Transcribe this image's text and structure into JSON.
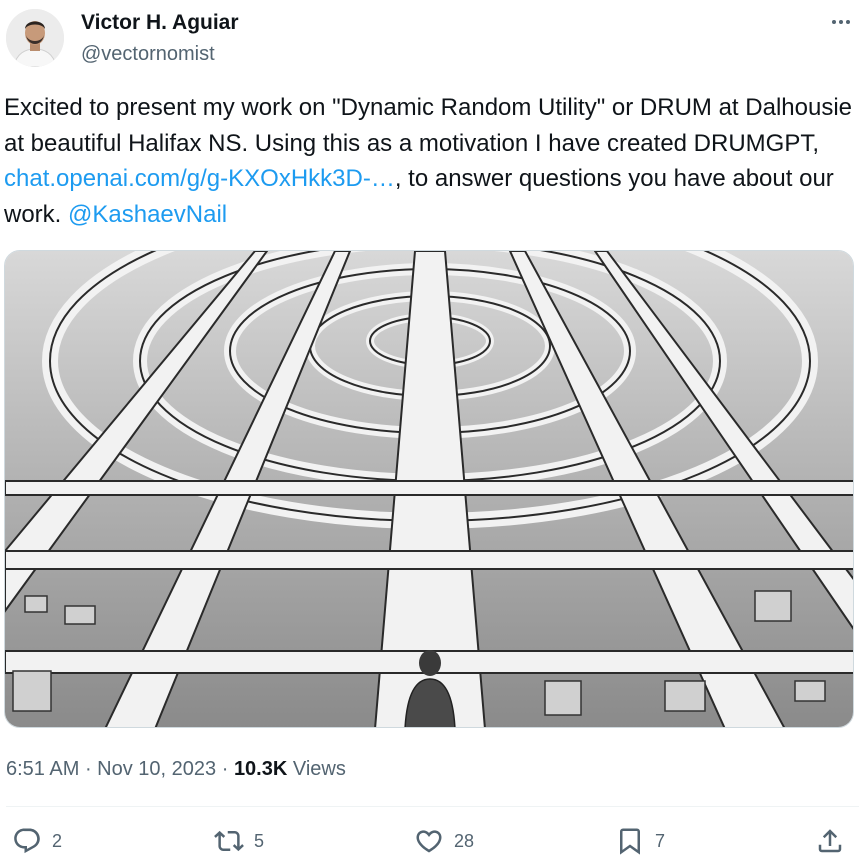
{
  "author": {
    "name": "Victor H. Aguiar",
    "handle": "@vectornomist"
  },
  "tweet": {
    "text_1": "Excited to present my work on \"Dynamic Random Utility\" or DRUM at Dalhousie at beautiful Halifax NS. Using this as a motivation I have created DRUMGPT, ",
    "link": "chat.openai.com/g/g-KXOxHkk3D-…",
    "text_2": ", to answer questions you have about our work. ",
    "mention": "@KashaevNail"
  },
  "meta": {
    "time": "6:51 AM",
    "sep1": " · ",
    "date": "Nov 10, 2023",
    "sep2": " · ",
    "views_count": "10.3K",
    "views_label": " Views"
  },
  "actions": {
    "replies": "2",
    "retweets": "5",
    "likes": "28",
    "bookmarks": "7"
  },
  "icons": {
    "more": "more-icon",
    "reply": "reply-icon",
    "retweet": "retweet-icon",
    "like": "heart-icon",
    "bookmark": "bookmark-icon",
    "share": "share-icon"
  },
  "colors": {
    "link": "#1d9bf0",
    "text": "#0f1419",
    "secondary": "#536471"
  }
}
